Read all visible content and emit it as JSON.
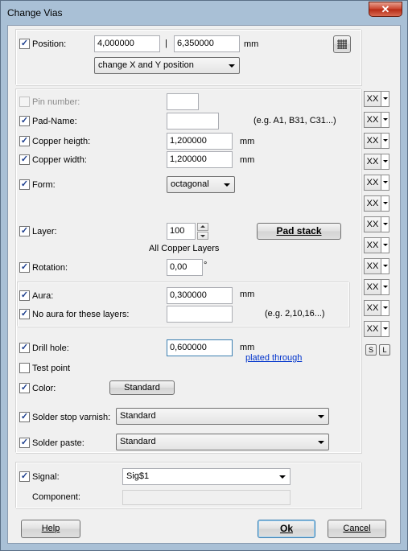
{
  "window": {
    "title": "Change Vias",
    "close_glyph": "✕"
  },
  "position": {
    "label": "Position:",
    "x": "4,000000",
    "sep": "|",
    "y": "6,350000",
    "unit": "mm",
    "mode": "change X and Y position"
  },
  "pin_number": {
    "label": "Pin number:",
    "value": ""
  },
  "pad_name": {
    "label": "Pad-Name:",
    "value": "",
    "hint": "(e.g. A1, B31, C31...)"
  },
  "copper_height": {
    "label": "Copper heigth:",
    "value": "1,200000",
    "unit": "mm"
  },
  "copper_width": {
    "label": "Copper width:",
    "value": "1,200000",
    "unit": "mm"
  },
  "form": {
    "label": "Form:",
    "value": "octagonal"
  },
  "layer": {
    "label": "Layer:",
    "value": "100",
    "desc": "All Copper Layers",
    "pad_stack_label": "Pad stack"
  },
  "rotation": {
    "label": "Rotation:",
    "value": "0,00",
    "unit": "°"
  },
  "aura": {
    "label": "Aura:",
    "value": "0,300000",
    "unit": "mm"
  },
  "no_aura": {
    "label": "No aura for these layers:",
    "value": "",
    "hint": "(e.g. 2,10,16...)"
  },
  "drill": {
    "label": "Drill hole:",
    "value": "0,600000",
    "unit": "mm",
    "link": "plated through"
  },
  "test_point": {
    "label": "Test point"
  },
  "color": {
    "label": "Color:",
    "button": "Standard"
  },
  "solder_stop": {
    "label": "Solder stop varnish:",
    "value": "Standard"
  },
  "solder_paste": {
    "label": "Solder paste:",
    "value": "Standard"
  },
  "signal": {
    "label": "Signal:",
    "value": "Sig$1"
  },
  "component": {
    "label": "Component:",
    "value": ""
  },
  "side": {
    "xx_label": "XX",
    "s_label": "S",
    "l_label": "L"
  },
  "buttons": {
    "help": "Help",
    "ok": "Ok",
    "cancel": "Cancel"
  },
  "check": "✓"
}
